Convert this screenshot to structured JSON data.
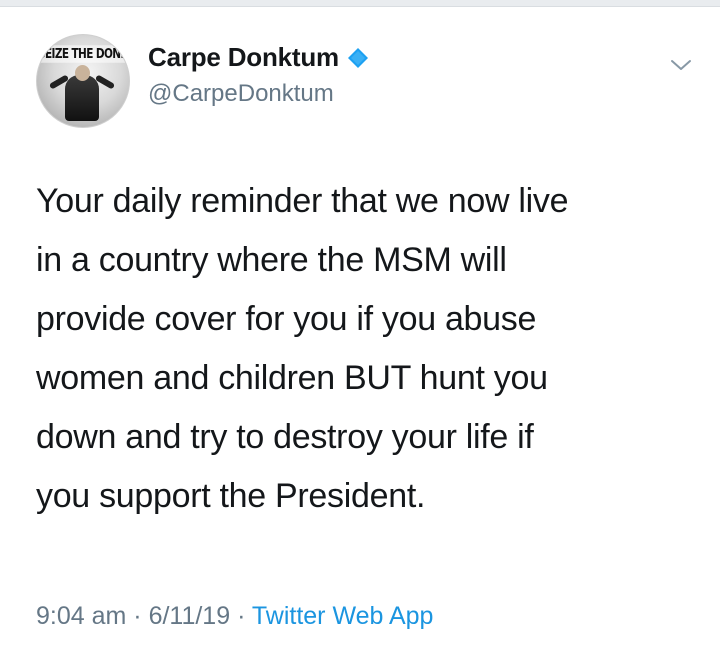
{
  "tweet": {
    "avatar": {
      "banner_text": "SEIZE THE DONK"
    },
    "author": {
      "display_name": "Carpe Donktum",
      "handle": "@CarpeDonktum",
      "verified_icon": "verified-badge-icon",
      "verified_color": "#1da1f2"
    },
    "menu_icon": "chevron-down-icon",
    "text_lines": [
      "Your daily reminder that we now live",
      "in a country where the MSM will",
      "provide cover for you if you abuse",
      "women and children BUT hunt you",
      "down and try to destroy your life if",
      "you support the President."
    ],
    "meta": {
      "time": "9:04 am",
      "sep1": " · ",
      "date": "6/11/19",
      "sep2": " · ",
      "source": "Twitter Web App"
    },
    "colors": {
      "text": "#14171a",
      "secondary": "#657786",
      "link": "#1b95e0"
    }
  }
}
